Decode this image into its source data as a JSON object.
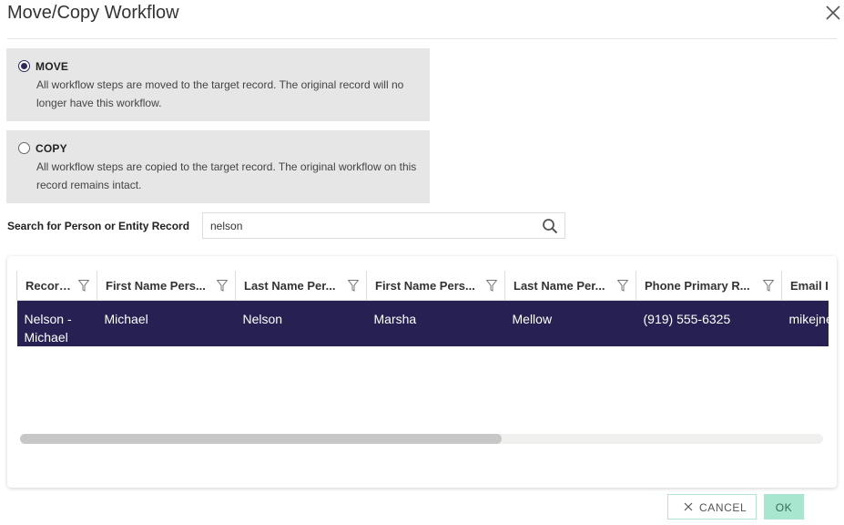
{
  "dialog": {
    "title": "Move/Copy Workflow",
    "close_icon": "close-icon"
  },
  "options": {
    "move": {
      "label": "MOVE",
      "description": "All workflow steps are moved to the target record. The original record will no longer have this workflow.",
      "selected": true
    },
    "copy": {
      "label": "COPY",
      "description": "All workflow steps are copied to the target record. The original workflow on this record remains intact.",
      "selected": false
    }
  },
  "search": {
    "label": "Search for Person or Entity Record",
    "value": "nelson",
    "icon": "search-icon"
  },
  "grid": {
    "columns": [
      "Record...",
      "First Name Pers...",
      "Last Name Per...",
      "First Name Pers...",
      "Last Name Per...",
      "Phone Primary R...",
      "Email I"
    ],
    "rows": [
      {
        "cells": [
          "Nelson - Michael",
          "Michael",
          "Nelson",
          "Marsha",
          "Mellow",
          "(919) 555-6325",
          "mikejne"
        ]
      }
    ],
    "selected_row_color": "#262152",
    "scroll_fraction_visible": 0.6
  },
  "buttons": {
    "cancel": "CANCEL",
    "ok": "OK"
  },
  "colors": {
    "accent": "#2b2a5a",
    "ok_button": "#a8e6cf",
    "option_bg": "#e6e6e6"
  }
}
